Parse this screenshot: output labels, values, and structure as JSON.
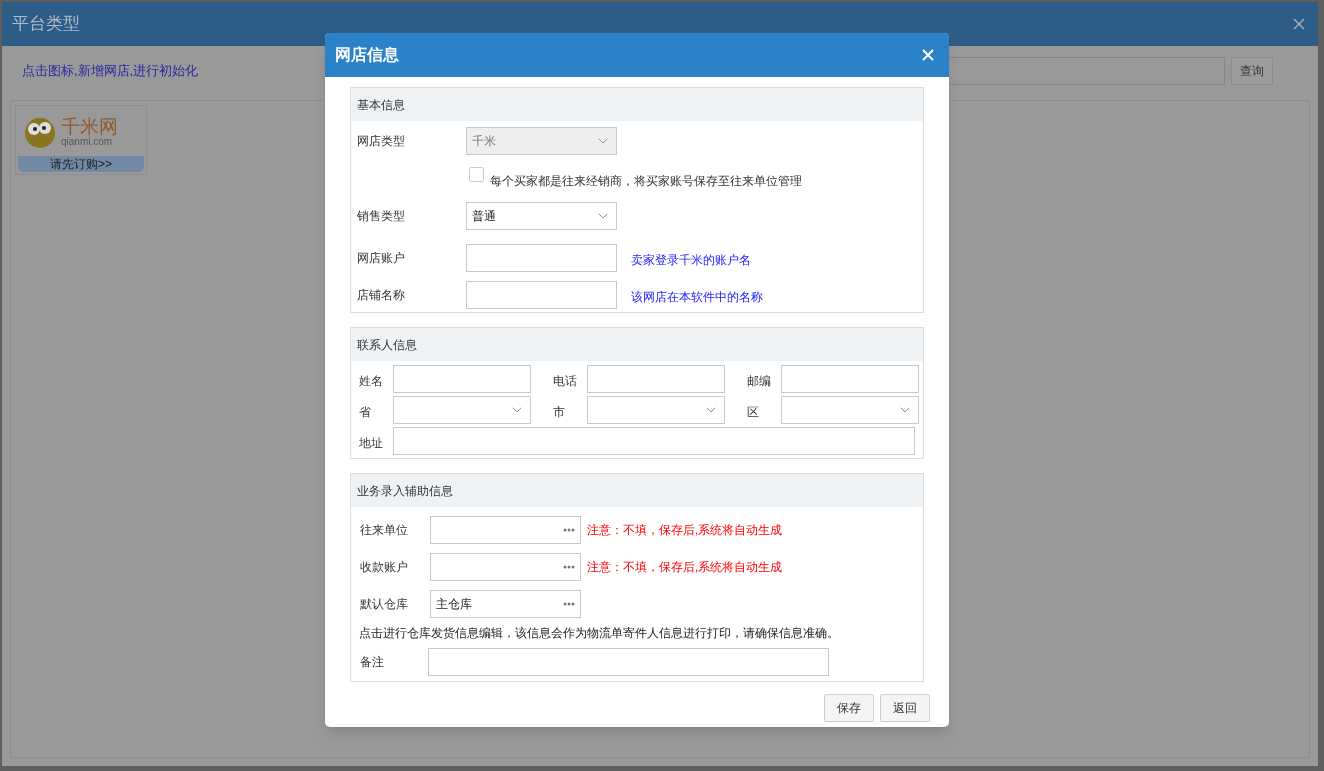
{
  "background_window": {
    "title": "平台类型",
    "hint_link": "点击图标,新增网店,进行初始化",
    "query_button": "查询",
    "platforms": [
      {
        "logo_text": "千米网",
        "domain": "qianmi.com",
        "action": "请先订购>>"
      }
    ]
  },
  "dialog": {
    "title": "网店信息",
    "basic": {
      "title": "基本信息",
      "rows": [
        {
          "kind": "select",
          "label": "网店类型",
          "value": "千米",
          "disabled": true
        },
        {
          "kind": "checkbox",
          "label": "每个买家都是往来经销商，将买家账号保存至往来单位管理",
          "checked": false
        },
        {
          "kind": "select",
          "label": "销售类型",
          "value": "普通",
          "disabled": false
        },
        {
          "kind": "input",
          "label": "网店账户",
          "hint": "卖家登录千米的账户名"
        },
        {
          "kind": "input",
          "label": "店铺名称",
          "hint": "该网店在本软件中的名称"
        }
      ]
    },
    "contact": {
      "title": "联系人信息",
      "fields": [
        {
          "kind": "input",
          "label": "姓名"
        },
        {
          "kind": "input",
          "label": "电话"
        },
        {
          "kind": "input",
          "label": "邮编"
        },
        {
          "kind": "select",
          "label": "省"
        },
        {
          "kind": "select",
          "label": "市"
        },
        {
          "kind": "select",
          "label": "区"
        }
      ],
      "address": {
        "label": "地址"
      }
    },
    "business": {
      "title": "业务录入辅助信息",
      "rows": [
        {
          "kind": "picker",
          "label": "往来单位",
          "note": "注意：不填，保存后,系统将自动生成"
        },
        {
          "kind": "picker",
          "label": "收款账户",
          "note": "注意：不填，保存后,系统将自动生成"
        },
        {
          "kind": "picker",
          "label": "默认仓库",
          "value": "主仓库"
        },
        {
          "kind": "text",
          "text": "点击进行仓库发货信息编辑，该信息会作为物流单寄件人信息进行打印，请确保信息准确。"
        },
        {
          "kind": "input",
          "label": "备注"
        }
      ]
    },
    "buttons": [
      "保存",
      "返回"
    ]
  }
}
